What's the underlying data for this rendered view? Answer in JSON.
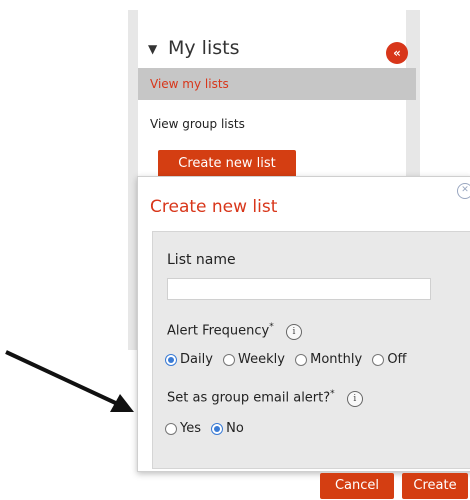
{
  "sidebar": {
    "title": "My lists",
    "collapse_icon": "double-chevron-left-icon",
    "items": [
      {
        "label": "View my lists",
        "active": true
      },
      {
        "label": "View group lists",
        "active": false
      }
    ],
    "create_button": "Create new list"
  },
  "popup": {
    "title": "Create new list",
    "list_name_label": "List name",
    "list_name_value": "",
    "alert_frequency_label": "Alert Frequency",
    "alert_frequency_options": [
      {
        "label": "Daily",
        "checked": true
      },
      {
        "label": "Weekly",
        "checked": false
      },
      {
        "label": "Monthly",
        "checked": false
      },
      {
        "label": "Off",
        "checked": false
      }
    ],
    "group_alert_label": "Set as group email alert?",
    "group_alert_options": [
      {
        "label": "Yes",
        "checked": false
      },
      {
        "label": "No",
        "checked": true
      }
    ],
    "required_mark": "*",
    "info_glyph": "i"
  },
  "buttons": {
    "cancel": "Cancel",
    "create": "Create"
  },
  "colors": {
    "accent": "#d43e12",
    "title_red": "#d8361a",
    "radio_blue": "#3a7bd5"
  }
}
